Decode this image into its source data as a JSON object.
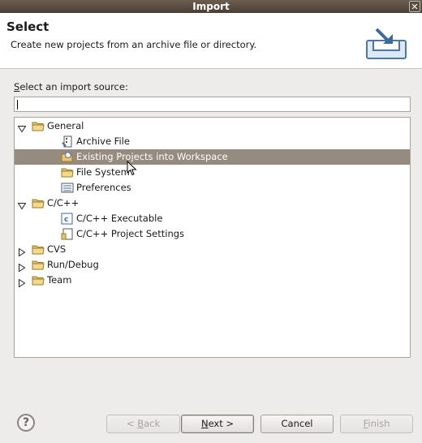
{
  "window": {
    "title": "Import",
    "close_glyph": "✕"
  },
  "header": {
    "title": "Select",
    "description": "Create new projects from an archive file or directory.",
    "banner_icon": "import-banner-icon"
  },
  "source": {
    "label": "Select an import source:",
    "mnemonic": "S",
    "label_rest": "elect an import source:",
    "filter_value": ""
  },
  "tree": [
    {
      "label": "General",
      "type": "folder",
      "level": 0,
      "expanded": true
    },
    {
      "label": "Archive File",
      "type": "archive",
      "level": 1
    },
    {
      "label": "Existing Projects into Workspace",
      "type": "project",
      "level": 1,
      "selected": true
    },
    {
      "label": "File System",
      "type": "folder",
      "level": 1
    },
    {
      "label": "Preferences",
      "type": "preferences",
      "level": 1
    },
    {
      "label": "C/C++",
      "type": "folder",
      "level": 0,
      "expanded": true
    },
    {
      "label": "C/C++ Executable",
      "type": "c-exec",
      "level": 1
    },
    {
      "label": "C/C++ Project Settings",
      "type": "c-settings",
      "level": 1
    },
    {
      "label": "CVS",
      "type": "folder",
      "level": 0,
      "expanded": false
    },
    {
      "label": "Run/Debug",
      "type": "folder",
      "level": 0,
      "expanded": false
    },
    {
      "label": "Team",
      "type": "folder",
      "level": 0,
      "expanded": false
    }
  ],
  "buttons": {
    "help": "?",
    "back": "< Back",
    "next": "Next >",
    "cancel": "Cancel",
    "finish": "Finish"
  },
  "colors": {
    "selection": "#968b7f",
    "titlebar": "#4a3f33"
  }
}
